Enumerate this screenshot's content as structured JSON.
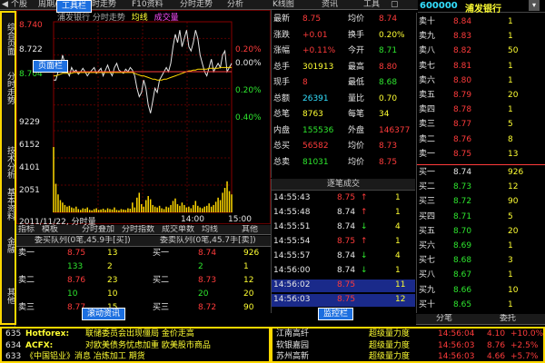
{
  "toolbar": {
    "items": [
      "个股",
      "周期/资料",
      "分时走势",
      "F10资料",
      "分时走势",
      "分析",
      "K线图",
      "资讯",
      "工具"
    ]
  },
  "stock": {
    "code": "600000",
    "name": "浦发银行"
  },
  "callouts": {
    "toolbar": "工具栏",
    "page": "页面栏",
    "news": "滚动资讯",
    "monitor": "监控栏"
  },
  "left_tabs": [
    "综合页面",
    "分时走势",
    "技术分析",
    "基本资料",
    "金融",
    "其他"
  ],
  "chart": {
    "header_name": "浦发银行 分时走势",
    "legend_avg": "均线",
    "legend_volume": "成交量"
  },
  "chart_tabs": [
    "指标",
    "模板",
    "分时叠加",
    "分时指数",
    "成交单数",
    "均线",
    "其他"
  ],
  "chart_data": {
    "type": "line",
    "x_axis_labels": [
      "2011/11/22, 分时量",
      "14:00",
      "15:00"
    ],
    "y_left_labels": [
      "8.740",
      "8.722",
      "8.704",
      "9229",
      "6152",
      "4101",
      "2051"
    ],
    "y_right_labels": [
      "0.20%",
      "0.00%",
      "0.20%",
      "0.40%"
    ],
    "price_min": 8.68,
    "price_max": 8.8,
    "reference_price": 8.74,
    "volume_max": 10000,
    "price": [
      8.73,
      8.73,
      8.74,
      8.745,
      8.76,
      8.75,
      8.74,
      8.735,
      8.745,
      8.74,
      8.742,
      8.737,
      8.74,
      8.744,
      8.74,
      8.735,
      8.739,
      8.742,
      8.745,
      8.738,
      8.741,
      8.744,
      8.735,
      8.742,
      8.748,
      8.74,
      8.735,
      8.745,
      8.75,
      8.742,
      8.74,
      8.738,
      8.743,
      8.74,
      8.745,
      8.742,
      8.735,
      8.72,
      8.71,
      8.715,
      8.73,
      8.72,
      8.7,
      8.69,
      8.705,
      8.72,
      8.715,
      8.73,
      8.735,
      8.74,
      8.745,
      8.74,
      8.75,
      8.77,
      8.785,
      8.775,
      8.79,
      8.77,
      8.78,
      8.79,
      8.77,
      8.765,
      8.775,
      8.79,
      8.78,
      8.76,
      8.75,
      8.74,
      8.735,
      8.745,
      8.755,
      8.74,
      8.745,
      8.75,
      8.745,
      8.76,
      8.765,
      8.74,
      8.745,
      8.75
    ],
    "average": [
      8.735,
      8.735,
      8.736,
      8.737,
      8.738,
      8.738,
      8.738,
      8.738,
      8.738,
      8.739,
      8.739,
      8.739,
      8.739,
      8.739,
      8.739,
      8.739,
      8.739,
      8.739,
      8.739,
      8.739,
      8.739,
      8.739,
      8.739,
      8.739,
      8.739,
      8.739,
      8.739,
      8.739,
      8.739,
      8.739,
      8.739,
      8.739,
      8.739,
      8.739,
      8.739,
      8.739,
      8.738,
      8.737,
      8.736,
      8.735,
      8.735,
      8.734,
      8.733,
      8.732,
      8.731,
      8.731,
      8.73,
      8.73,
      8.73,
      8.731,
      8.731,
      8.732,
      8.733,
      8.734,
      8.735,
      8.736,
      8.737,
      8.738,
      8.739,
      8.74,
      8.741,
      8.741,
      8.742,
      8.742,
      8.743,
      8.743,
      8.743,
      8.743,
      8.743,
      8.744,
      8.744,
      8.744,
      8.744,
      8.744,
      8.745,
      8.745,
      8.745,
      8.745,
      8.745,
      8.745
    ],
    "volume": [
      8000,
      3500,
      2200,
      1500,
      1200,
      900,
      700,
      800,
      600,
      500,
      700,
      400,
      300,
      500,
      450,
      600,
      300,
      250,
      400,
      500,
      300,
      350,
      450,
      300,
      500,
      400,
      350,
      600,
      300,
      250,
      400,
      350,
      300,
      500,
      450,
      1200,
      600,
      1800,
      2400,
      1000,
      700,
      1500,
      2000,
      1600,
      900,
      700,
      600,
      800,
      500,
      400,
      700,
      600,
      900,
      1400,
      1700,
      1000,
      800,
      1200,
      900,
      600,
      700,
      500,
      900,
      1400,
      800,
      600,
      500,
      700,
      800,
      1100,
      700,
      900,
      1300,
      1800,
      1500,
      2400,
      3000,
      3800,
      2600,
      2200
    ]
  },
  "order_queue": {
    "ask_title": "委买队列(0笔,45.9手[买])",
    "bid_title": "委卖队列(0笔,45.7手[卖])",
    "rows": [
      {
        "l_label": "卖一",
        "l_price": "8.75",
        "l_vol": "13",
        "r_label": "买一",
        "r_price": "8.74",
        "r_vol": "926"
      },
      {
        "l_label": "",
        "l_price": "133",
        "l_vol": "2",
        "r_label": "",
        "r_price": "2",
        "r_vol": "1"
      },
      {
        "l_label": "卖二",
        "l_price": "8.76",
        "l_vol": "23",
        "r_label": "买二",
        "r_price": "8.73",
        "r_vol": "12"
      },
      {
        "l_label": "",
        "l_price": "10",
        "l_vol": "10",
        "r_label": "",
        "r_price": "20",
        "r_vol": "20"
      },
      {
        "l_label": "卖三",
        "l_price": "8.77",
        "l_vol": "15",
        "r_label": "买三",
        "r_price": "8.72",
        "r_vol": "90"
      }
    ]
  },
  "quote": {
    "rows": [
      {
        "a": "最新",
        "b": "8.75",
        "c": "均价",
        "d": "8.74",
        "bc": "red",
        "dc": "red"
      },
      {
        "a": "涨跌",
        "b": "+0.01",
        "c": "换手",
        "d": "0.20%",
        "bc": "red",
        "dc": "yellow"
      },
      {
        "a": "涨幅",
        "b": "+0.11%",
        "c": "今开",
        "d": "8.71",
        "bc": "red",
        "dc": "green"
      },
      {
        "a": "总手",
        "b": "301913",
        "c": "最高",
        "d": "8.80",
        "bc": "yellow",
        "dc": "red"
      },
      {
        "a": "现手",
        "b": "8",
        "c": "最低",
        "d": "8.68",
        "bc": "red",
        "dc": "green"
      },
      {
        "a": "总额",
        "b": "26391",
        "c": "量比",
        "d": "0.70",
        "bc": "cyan",
        "dc": "yellow"
      },
      {
        "a": "总笔",
        "b": "8763",
        "c": "每笔",
        "d": "34",
        "bc": "yellow",
        "dc": "yellow"
      },
      {
        "a": "内盘",
        "b": "155536",
        "c": "外盘",
        "d": "146377",
        "bc": "green",
        "dc": "red"
      },
      {
        "a": "总买",
        "b": "56582",
        "c": "均价",
        "d": "8.73",
        "bc": "red",
        "dc": "red"
      },
      {
        "a": "总卖",
        "b": "81031",
        "c": "均价",
        "d": "8.75",
        "bc": "green",
        "dc": "red"
      }
    ]
  },
  "ticks": {
    "title": "逐笔成交",
    "rows": [
      {
        "t": "14:55:43",
        "p": "8.75",
        "v": "1",
        "dir": "up",
        "pc": "red",
        "hl": false
      },
      {
        "t": "14:55:48",
        "p": "8.74",
        "v": "1",
        "dir": "up",
        "pc": "white",
        "hl": false
      },
      {
        "t": "14:55:51",
        "p": "8.74",
        "v": "4",
        "dir": "down",
        "pc": "white",
        "hl": false
      },
      {
        "t": "14:55:54",
        "p": "8.75",
        "v": "1",
        "dir": "up",
        "pc": "red",
        "hl": false
      },
      {
        "t": "14:55:57",
        "p": "8.74",
        "v": "4",
        "dir": "down",
        "pc": "white",
        "hl": false
      },
      {
        "t": "14:56:00",
        "p": "8.74",
        "v": "1",
        "dir": "down",
        "pc": "white",
        "hl": false
      },
      {
        "t": "14:56:02",
        "p": "8.75",
        "v": "11",
        "dir": "",
        "pc": "red",
        "hl": true
      },
      {
        "t": "14:56:03",
        "p": "8.75",
        "v": "12",
        "dir": "",
        "pc": "red",
        "hl": true
      }
    ]
  },
  "book": {
    "rows": [
      {
        "label": "卖十",
        "price": "8.84",
        "vol": "1"
      },
      {
        "label": "卖九",
        "price": "8.83",
        "vol": "1"
      },
      {
        "label": "卖八",
        "price": "8.82",
        "vol": "50"
      },
      {
        "label": "卖七",
        "price": "8.81",
        "vol": "1"
      },
      {
        "label": "卖六",
        "price": "8.80",
        "vol": "1"
      },
      {
        "label": "卖五",
        "price": "8.79",
        "vol": "20"
      },
      {
        "label": "卖四",
        "price": "8.78",
        "vol": "1"
      },
      {
        "label": "卖三",
        "price": "8.77",
        "vol": "5"
      },
      {
        "label": "卖二",
        "price": "8.76",
        "vol": "8"
      },
      {
        "label": "卖一",
        "price": "8.75",
        "vol": "13"
      },
      {
        "label": "买一",
        "price": "8.74",
        "vol": "926"
      },
      {
        "label": "买二",
        "price": "8.73",
        "vol": "12"
      },
      {
        "label": "买三",
        "price": "8.72",
        "vol": "90"
      },
      {
        "label": "买四",
        "price": "8.71",
        "vol": "5"
      },
      {
        "label": "买五",
        "price": "8.70",
        "vol": "20"
      },
      {
        "label": "买六",
        "price": "8.69",
        "vol": "1"
      },
      {
        "label": "买七",
        "price": "8.68",
        "vol": "3"
      },
      {
        "label": "买八",
        "price": "8.67",
        "vol": "1"
      },
      {
        "label": "买九",
        "price": "8.66",
        "vol": "10"
      },
      {
        "label": "买十",
        "price": "8.65",
        "vol": "1"
      }
    ]
  },
  "book_tabs": [
    "分笔",
    "委托"
  ],
  "news": {
    "rows": [
      {
        "num": "635",
        "src": "Hotforex:",
        "text": "联储委员会出现僵局 金价走高"
      },
      {
        "num": "634",
        "src": "ACFX:",
        "text": "对欧美债务忧虑加重 欧美股市商品"
      },
      {
        "num": "633",
        "src": "",
        "text": "《中国铝业》消息 冶炼加工 期货"
      }
    ]
  },
  "monitor": {
    "rows": [
      {
        "name": "江南高纤",
        "tag": "超级量力度",
        "time": "14:56:04",
        "val": "4.10",
        "pct": "+10.0%"
      },
      {
        "name": "软银嘉园",
        "tag": "超级量力度",
        "time": "14:56:03",
        "val": "8.76",
        "pct": "+2.5%"
      },
      {
        "name": "苏州高新",
        "tag": "超级量力度",
        "time": "14:56:03",
        "val": "4.66",
        "pct": "+5.7%"
      }
    ]
  }
}
